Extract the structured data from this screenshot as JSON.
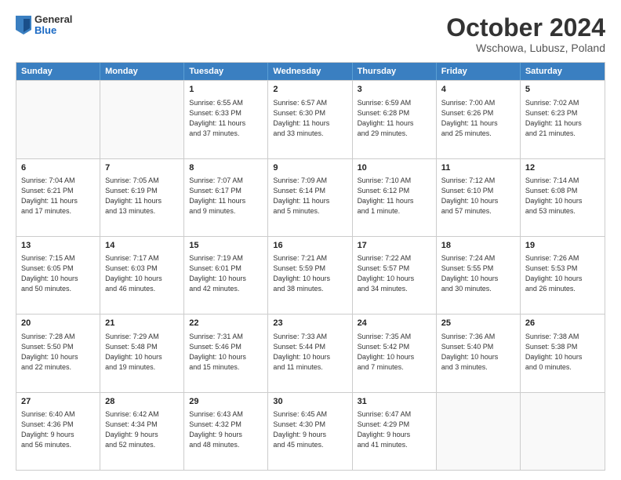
{
  "logo": {
    "general": "General",
    "blue": "Blue"
  },
  "title": "October 2024",
  "location": "Wschowa, Lubusz, Poland",
  "days": [
    "Sunday",
    "Monday",
    "Tuesday",
    "Wednesday",
    "Thursday",
    "Friday",
    "Saturday"
  ],
  "weeks": [
    [
      {
        "day": "",
        "text": ""
      },
      {
        "day": "",
        "text": ""
      },
      {
        "day": "1",
        "text": "Sunrise: 6:55 AM\nSunset: 6:33 PM\nDaylight: 11 hours\nand 37 minutes."
      },
      {
        "day": "2",
        "text": "Sunrise: 6:57 AM\nSunset: 6:30 PM\nDaylight: 11 hours\nand 33 minutes."
      },
      {
        "day": "3",
        "text": "Sunrise: 6:59 AM\nSunset: 6:28 PM\nDaylight: 11 hours\nand 29 minutes."
      },
      {
        "day": "4",
        "text": "Sunrise: 7:00 AM\nSunset: 6:26 PM\nDaylight: 11 hours\nand 25 minutes."
      },
      {
        "day": "5",
        "text": "Sunrise: 7:02 AM\nSunset: 6:23 PM\nDaylight: 11 hours\nand 21 minutes."
      }
    ],
    [
      {
        "day": "6",
        "text": "Sunrise: 7:04 AM\nSunset: 6:21 PM\nDaylight: 11 hours\nand 17 minutes."
      },
      {
        "day": "7",
        "text": "Sunrise: 7:05 AM\nSunset: 6:19 PM\nDaylight: 11 hours\nand 13 minutes."
      },
      {
        "day": "8",
        "text": "Sunrise: 7:07 AM\nSunset: 6:17 PM\nDaylight: 11 hours\nand 9 minutes."
      },
      {
        "day": "9",
        "text": "Sunrise: 7:09 AM\nSunset: 6:14 PM\nDaylight: 11 hours\nand 5 minutes."
      },
      {
        "day": "10",
        "text": "Sunrise: 7:10 AM\nSunset: 6:12 PM\nDaylight: 11 hours\nand 1 minute."
      },
      {
        "day": "11",
        "text": "Sunrise: 7:12 AM\nSunset: 6:10 PM\nDaylight: 10 hours\nand 57 minutes."
      },
      {
        "day": "12",
        "text": "Sunrise: 7:14 AM\nSunset: 6:08 PM\nDaylight: 10 hours\nand 53 minutes."
      }
    ],
    [
      {
        "day": "13",
        "text": "Sunrise: 7:15 AM\nSunset: 6:05 PM\nDaylight: 10 hours\nand 50 minutes."
      },
      {
        "day": "14",
        "text": "Sunrise: 7:17 AM\nSunset: 6:03 PM\nDaylight: 10 hours\nand 46 minutes."
      },
      {
        "day": "15",
        "text": "Sunrise: 7:19 AM\nSunset: 6:01 PM\nDaylight: 10 hours\nand 42 minutes."
      },
      {
        "day": "16",
        "text": "Sunrise: 7:21 AM\nSunset: 5:59 PM\nDaylight: 10 hours\nand 38 minutes."
      },
      {
        "day": "17",
        "text": "Sunrise: 7:22 AM\nSunset: 5:57 PM\nDaylight: 10 hours\nand 34 minutes."
      },
      {
        "day": "18",
        "text": "Sunrise: 7:24 AM\nSunset: 5:55 PM\nDaylight: 10 hours\nand 30 minutes."
      },
      {
        "day": "19",
        "text": "Sunrise: 7:26 AM\nSunset: 5:53 PM\nDaylight: 10 hours\nand 26 minutes."
      }
    ],
    [
      {
        "day": "20",
        "text": "Sunrise: 7:28 AM\nSunset: 5:50 PM\nDaylight: 10 hours\nand 22 minutes."
      },
      {
        "day": "21",
        "text": "Sunrise: 7:29 AM\nSunset: 5:48 PM\nDaylight: 10 hours\nand 19 minutes."
      },
      {
        "day": "22",
        "text": "Sunrise: 7:31 AM\nSunset: 5:46 PM\nDaylight: 10 hours\nand 15 minutes."
      },
      {
        "day": "23",
        "text": "Sunrise: 7:33 AM\nSunset: 5:44 PM\nDaylight: 10 hours\nand 11 minutes."
      },
      {
        "day": "24",
        "text": "Sunrise: 7:35 AM\nSunset: 5:42 PM\nDaylight: 10 hours\nand 7 minutes."
      },
      {
        "day": "25",
        "text": "Sunrise: 7:36 AM\nSunset: 5:40 PM\nDaylight: 10 hours\nand 3 minutes."
      },
      {
        "day": "26",
        "text": "Sunrise: 7:38 AM\nSunset: 5:38 PM\nDaylight: 10 hours\nand 0 minutes."
      }
    ],
    [
      {
        "day": "27",
        "text": "Sunrise: 6:40 AM\nSunset: 4:36 PM\nDaylight: 9 hours\nand 56 minutes."
      },
      {
        "day": "28",
        "text": "Sunrise: 6:42 AM\nSunset: 4:34 PM\nDaylight: 9 hours\nand 52 minutes."
      },
      {
        "day": "29",
        "text": "Sunrise: 6:43 AM\nSunset: 4:32 PM\nDaylight: 9 hours\nand 48 minutes."
      },
      {
        "day": "30",
        "text": "Sunrise: 6:45 AM\nSunset: 4:30 PM\nDaylight: 9 hours\nand 45 minutes."
      },
      {
        "day": "31",
        "text": "Sunrise: 6:47 AM\nSunset: 4:29 PM\nDaylight: 9 hours\nand 41 minutes."
      },
      {
        "day": "",
        "text": ""
      },
      {
        "day": "",
        "text": ""
      }
    ]
  ]
}
